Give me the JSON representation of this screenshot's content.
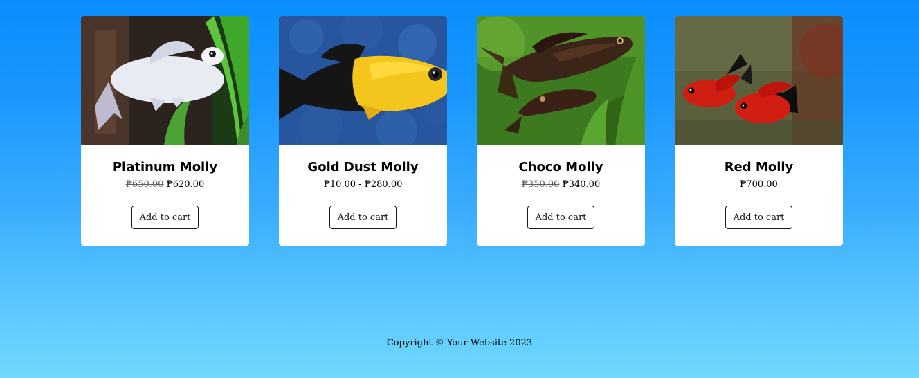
{
  "products": [
    {
      "name": "Platinum Molly",
      "price_original": "₱650.00",
      "price_current": "₱620.00",
      "button_label": "Add to cart"
    },
    {
      "name": "Gold Dust Molly",
      "price_range": "₱10.00 - ₱280.00",
      "button_label": "Add to cart"
    },
    {
      "name": "Choco Molly",
      "price_original": "₱350.00",
      "price_current": "₱340.00",
      "button_label": "Add to cart"
    },
    {
      "name": "Red Molly",
      "price_current": "₱700.00",
      "button_label": "Add to cart"
    }
  ],
  "footer": {
    "copyright": "Copyright © Your Website 2023"
  }
}
